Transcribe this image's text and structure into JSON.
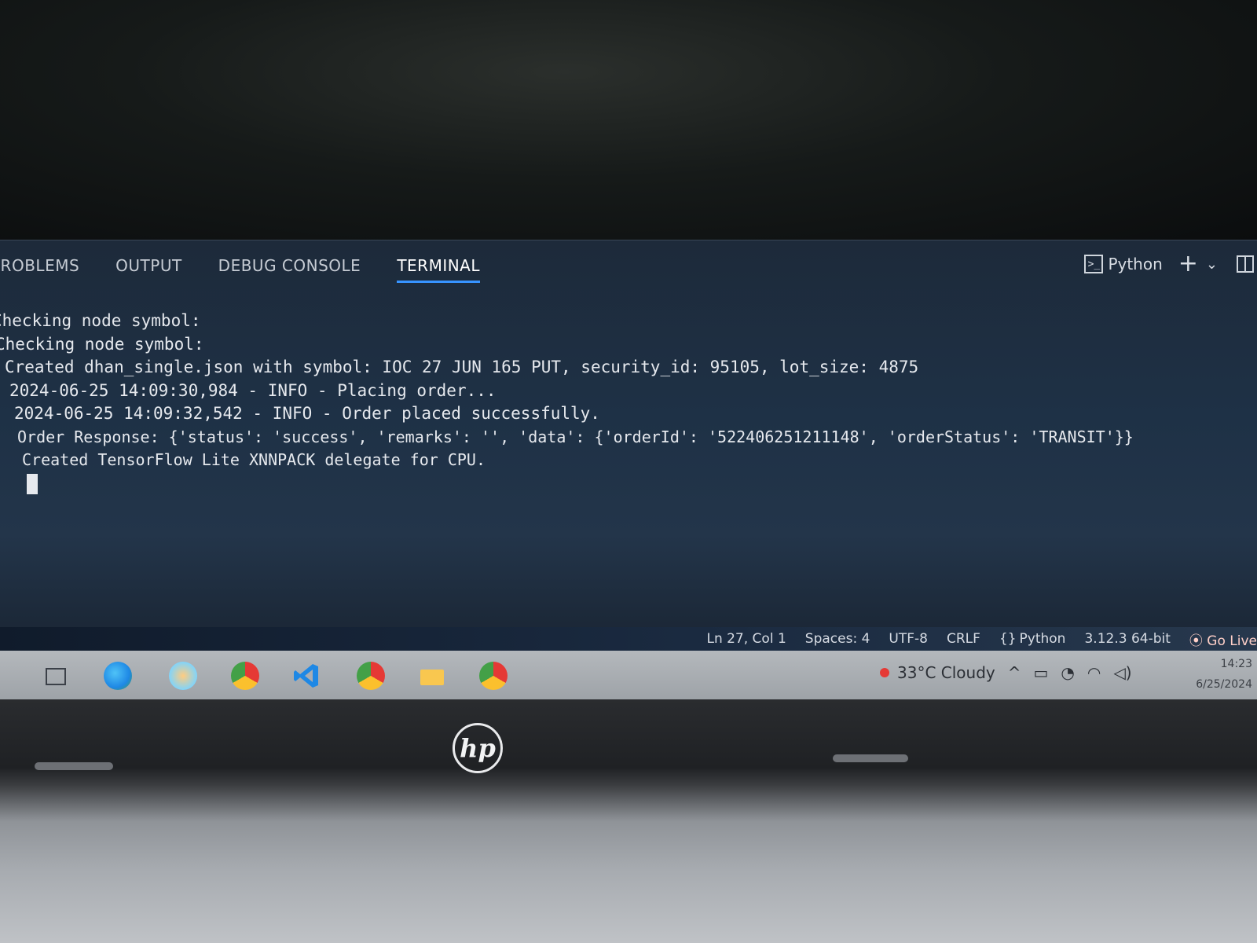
{
  "panel": {
    "tabs": [
      {
        "label": "PROBLEMS"
      },
      {
        "label": "OUTPUT"
      },
      {
        "label": "DEBUG CONSOLE"
      },
      {
        "label": "TERMINAL",
        "active": true
      }
    ],
    "terminal_profile": "Python",
    "add_label": "+",
    "dropdown_glyph": "⌄"
  },
  "terminal": {
    "lines": [
      "Checking node symbol:",
      "Checking node symbol:",
      "Created dhan_single.json with symbol: IOC 27 JUN 165 PUT, security_id: 95105, lot_size: 4875",
      "2024-06-25 14:09:30,984 - INFO - Placing order...",
      "2024-06-25 14:09:32,542 - INFO - Order placed successfully.",
      "Order Response: {'status': 'success', 'remarks': '', 'data': {'orderId': '522406251211148', 'orderStatus': 'TRANSIT'}}",
      "Created TensorFlow Lite XNNPACK delegate for CPU."
    ]
  },
  "status_bar": {
    "position": "Ln 27, Col 1",
    "spaces": "Spaces: 4",
    "encoding": "UTF-8",
    "eol": "CRLF",
    "language": "Python",
    "interpreter": "3.12.3 64-bit",
    "go_live": "Go Live"
  },
  "taskbar": {
    "weather": "33°C  Cloudy",
    "time": "14:23",
    "date": "6/25/2024"
  },
  "bezel": {
    "logo": "hp"
  },
  "colors": {
    "accent": "#3794ff",
    "terminal_bg": "#1e3146",
    "taskbar_bg": "#a9adb2"
  }
}
